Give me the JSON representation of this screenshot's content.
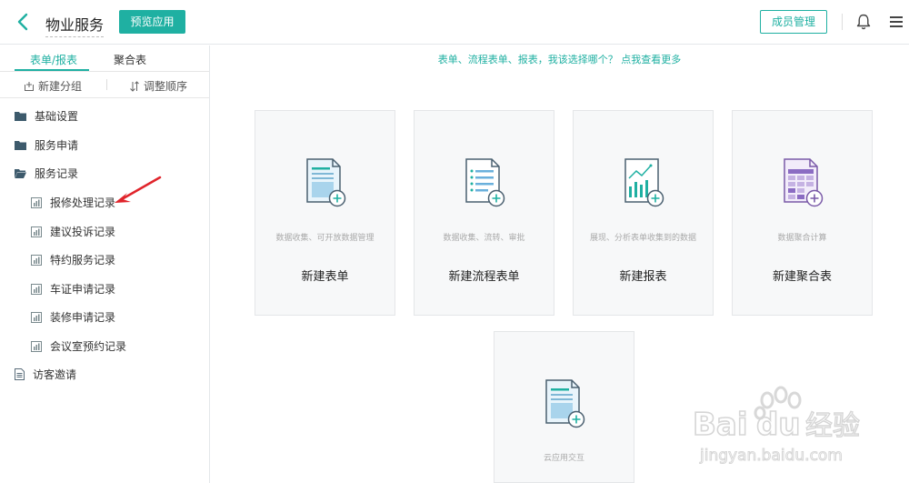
{
  "header": {
    "title": "物业服务",
    "preview_label": "预览应用",
    "members_label": "成员管理"
  },
  "sidebar": {
    "tabs": [
      {
        "label": "表单/报表",
        "active": true
      },
      {
        "label": "聚合表",
        "active": false
      }
    ],
    "actions": {
      "new_group": "新建分组",
      "reorder": "调整顺序"
    },
    "items": [
      {
        "label": "基础设置",
        "type": "folder"
      },
      {
        "label": "服务申请",
        "type": "folder"
      },
      {
        "label": "服务记录",
        "type": "folder-open"
      },
      {
        "label": "报修处理记录",
        "type": "report"
      },
      {
        "label": "建议投诉记录",
        "type": "report"
      },
      {
        "label": "特约服务记录",
        "type": "report"
      },
      {
        "label": "车证申请记录",
        "type": "report"
      },
      {
        "label": "装修申请记录",
        "type": "report"
      },
      {
        "label": "会议室预约记录",
        "type": "report"
      },
      {
        "label": "访客邀请",
        "type": "form"
      }
    ]
  },
  "main": {
    "hint": "表单、流程表单、报表，我该选择哪个？ 点我查看更多",
    "cards": [
      {
        "label": "新建表单",
        "desc": "数据收集、可开放数据管理",
        "icon": "form-icon"
      },
      {
        "label": "新建流程表单",
        "desc": "数据收集、流转、审批",
        "icon": "flow-form-icon"
      },
      {
        "label": "新建报表",
        "desc": "展现、分析表单收集到的数据",
        "icon": "report-icon"
      },
      {
        "label": "新建聚合表",
        "desc": "数据聚合计算",
        "icon": "aggregate-table-icon"
      },
      {
        "label": "",
        "desc": "云应用交互",
        "icon": "cloud-app-icon"
      }
    ]
  },
  "watermark": {
    "line1": "Bai du 经验",
    "line2": "jingyan.baidu.com"
  },
  "colors": {
    "accent": "#1fb0a2",
    "card_bg": "#f7f8f9",
    "report_icon": "#1fb0a2",
    "aggregate_icon": "#8b6cc3",
    "arrow": "#e0242b"
  }
}
